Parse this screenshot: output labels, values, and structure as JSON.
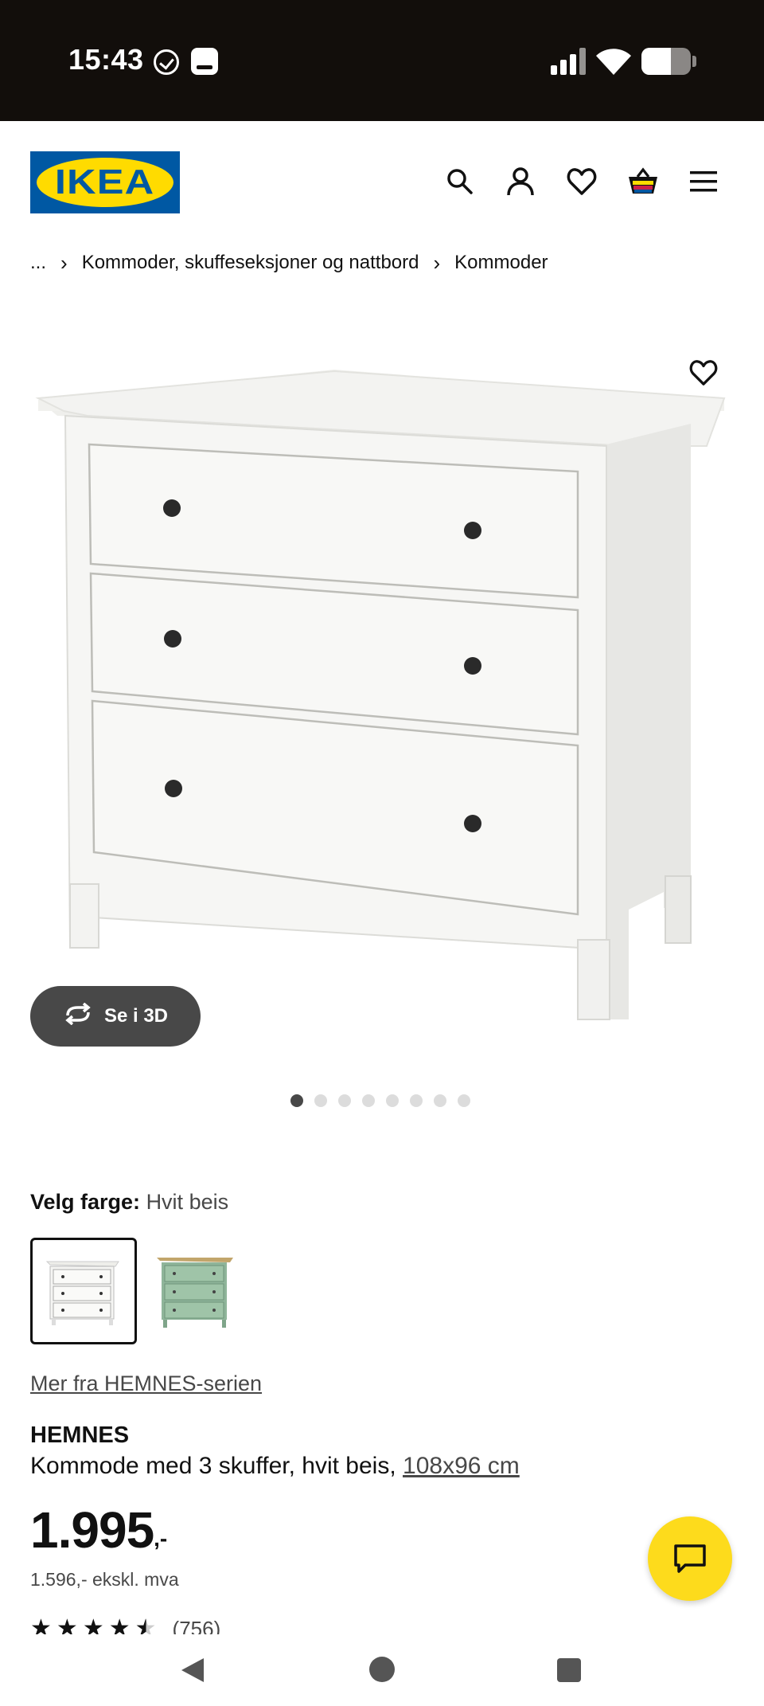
{
  "status_bar": {
    "time": "15:43",
    "icons": [
      "check-circle-icon",
      "app-notification-icon",
      "signal-icon",
      "wifi-icon",
      "battery-icon"
    ],
    "battery_level": 0.6
  },
  "header": {
    "logo_text": "IKEA",
    "icons": [
      "search-icon",
      "account-icon",
      "heart-icon",
      "cart-icon",
      "menu-icon"
    ]
  },
  "breadcrumb": {
    "items": [
      "...",
      "Kommoder, skuffeseksjoner og nattbord",
      "Kommoder"
    ]
  },
  "gallery": {
    "button_3d_label": "Se i 3D",
    "total_images": 8,
    "active_index": 0
  },
  "color_picker": {
    "label": "Velg farge:",
    "selected_value": "Hvit beis",
    "swatches": [
      "Hvit beis",
      "Grønn"
    ]
  },
  "product": {
    "series_link": "Mer fra HEMNES-serien",
    "name": "HEMNES",
    "description": "Kommode med 3 skuffer, hvit beis,",
    "dimensions": "108x96 cm",
    "price": "1.995",
    "price_suffix": ",-",
    "price_ex_vat": "1.596,- ekskl. mva",
    "rating": 4.5,
    "review_count": "(756)"
  },
  "colors": {
    "ikea_blue": "#0058a3",
    "ikea_yellow": "#ffdb00",
    "chat_yellow": "#fddb1c",
    "dark_button": "#484848"
  }
}
